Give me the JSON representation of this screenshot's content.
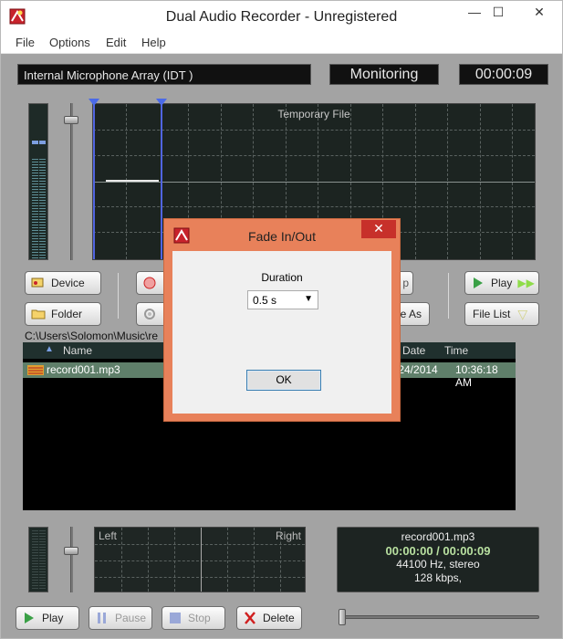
{
  "window": {
    "title": "Dual Audio Recorder - Unregistered",
    "minimize": "—",
    "maximize": "☐",
    "close": "✕"
  },
  "menu": [
    "File",
    "Options",
    "Edit",
    "Help"
  ],
  "top": {
    "device_name": "Internal Microphone Array (IDT )",
    "status": "Monitoring",
    "time": "00:00:09"
  },
  "waveform": {
    "label": "Temporary File"
  },
  "buttons": {
    "device": "Device",
    "folder": "Folder",
    "play_top": "Play",
    "file_list": "File List",
    "save_as_partial": "e As",
    "stop_partial": "p",
    "play": "Play",
    "pause": "Pause",
    "stop": "Stop",
    "delete": "Delete"
  },
  "path": "C:\\Users\\Solomon\\Music\\re",
  "list": {
    "columns": {
      "name": "Name",
      "date": "Date",
      "time": "Time",
      "sort_arrow": "▲"
    },
    "rows": [
      {
        "name": "record001.mp3",
        "date": "/24/2014",
        "time": "10:36:18 AM"
      }
    ]
  },
  "channels": {
    "left": "Left",
    "right": "Right"
  },
  "info": {
    "file": "record001.mp3",
    "position": "00:00:00 / 00:00:09",
    "format": "44100 Hz, stereo",
    "bitrate": "128 kbps,"
  },
  "dialog": {
    "title": "Fade In/Out",
    "close": "✕",
    "label": "Duration",
    "value": "0.5 s",
    "ok": "OK"
  },
  "colors": {
    "lcd_bg": "#111111",
    "panel_bg": "#1c2421",
    "dialog_border": "#e8815a",
    "row_selected": "#5f7f6a",
    "time_green": "#b8e0a0"
  }
}
